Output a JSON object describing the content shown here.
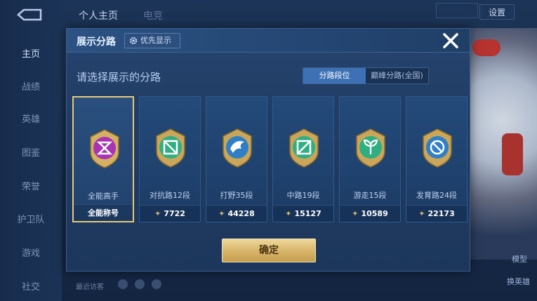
{
  "sidebar": {
    "items": [
      {
        "label": "主页",
        "active": true
      },
      {
        "label": "战绩"
      },
      {
        "label": "英雄"
      },
      {
        "label": "图鉴"
      },
      {
        "label": "荣誉"
      },
      {
        "label": "护卫队"
      },
      {
        "label": "游戏"
      },
      {
        "label": "社交"
      }
    ]
  },
  "top_tabs": [
    "个人主页",
    "电竞"
  ],
  "settings_label": "设置",
  "background": {
    "visit_text": "最近访客",
    "bottom_right_1": "模型",
    "bottom_right_2": "换英雄"
  },
  "modal": {
    "title": "展示分路",
    "priority_label": "优先显示",
    "prompt": "请选择展示的分路",
    "toggle": {
      "left": "分路段位",
      "right": "巅峰分路(全国)",
      "active": "left"
    },
    "confirm_label": "确定",
    "cards": [
      {
        "name": "全能高手",
        "footer": "全能称号",
        "selected": true,
        "icon": "all-round-emblem-icon",
        "color": "#b03bb8"
      },
      {
        "name": "对抗路12段",
        "score": "7722",
        "icon": "clash-lane-emblem-icon",
        "color": "#2fae82"
      },
      {
        "name": "打野35段",
        "score": "44228",
        "icon": "jungle-emblem-icon",
        "color": "#2f7fc7"
      },
      {
        "name": "中路19段",
        "score": "15127",
        "icon": "mid-lane-emblem-icon",
        "color": "#2fae82"
      },
      {
        "name": "游走15段",
        "score": "10589",
        "icon": "roam-emblem-icon",
        "color": "#2fae82"
      },
      {
        "name": "发育路24段",
        "score": "22173",
        "icon": "farm-lane-emblem-icon",
        "color": "#2f7fc7"
      }
    ]
  }
}
